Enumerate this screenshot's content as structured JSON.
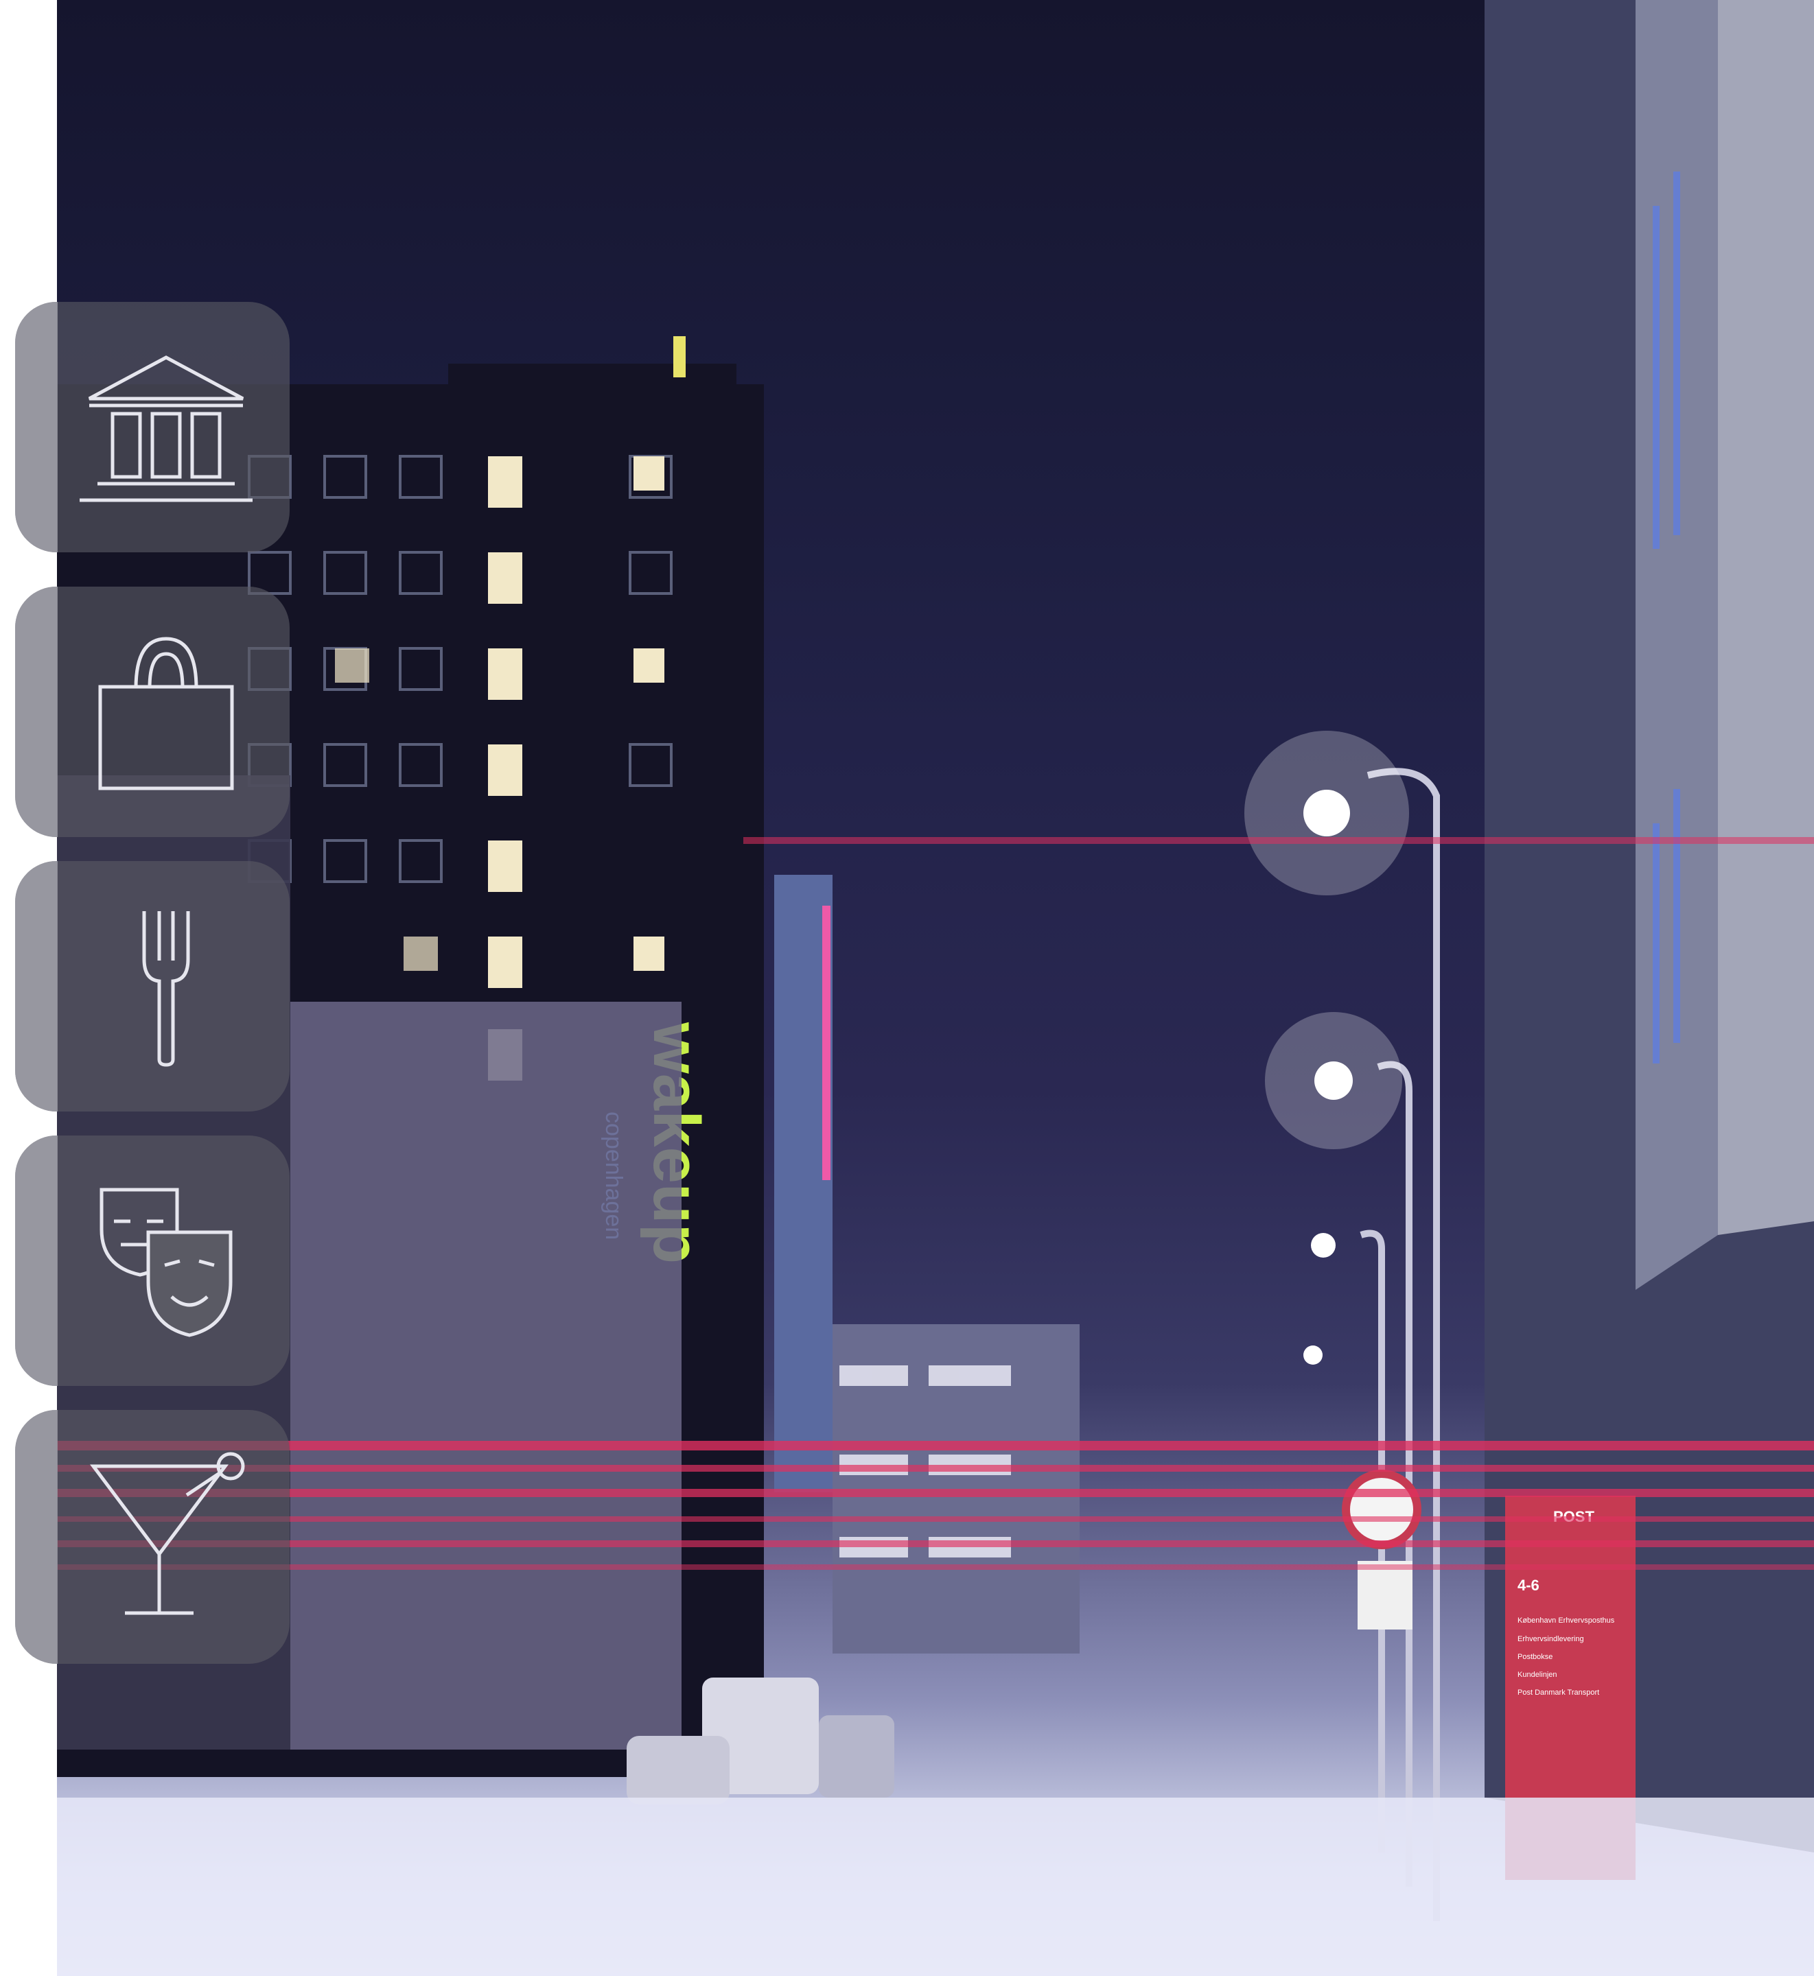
{
  "photo": {
    "description_alt": "",
    "sign_wakeup": "wakeup",
    "sign_wakeup_sub": "copenhagen",
    "post_sign": {
      "brand": "POST",
      "number": "4-6",
      "lines": [
        "København Erhvervsposthus",
        "Erhvervsindlevering",
        "Postbokse",
        "Kundelinjen",
        "Post Danmark Transport"
      ]
    }
  },
  "category_tabs": [
    {
      "id": "culture",
      "icon": "museum-icon"
    },
    {
      "id": "shopping",
      "icon": "shopping-bag-icon"
    },
    {
      "id": "food",
      "icon": "fork-icon"
    },
    {
      "id": "theatre",
      "icon": "theatre-masks-icon"
    },
    {
      "id": "nightlife",
      "icon": "cocktail-glass-icon"
    }
  ],
  "colors": {
    "tab_bg": "#5a5a64",
    "icon_stroke": "#e6e6ee",
    "neon_pink": "#e0305f"
  }
}
